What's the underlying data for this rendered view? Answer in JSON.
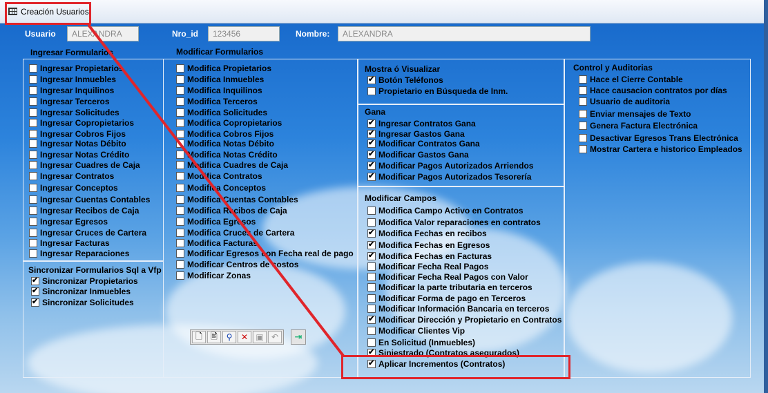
{
  "window": {
    "title": "Creación Usuarios"
  },
  "header": {
    "usuario_label": "Usuario",
    "usuario_value": "ALEXANDRA",
    "nro_id_label": "Nro_id",
    "nro_id_value": "123456",
    "nombre_label": "Nombre:",
    "nombre_value": "ALEXANDRA"
  },
  "ingresar": {
    "title": "Ingresar Formularios",
    "items": [
      {
        "label": "Ingresar Propietarios",
        "checked": false
      },
      {
        "label": "Ingresar Inmuebles",
        "checked": false
      },
      {
        "label": "Ingresar Inquilinos",
        "checked": false
      },
      {
        "label": "Ingresar Terceros",
        "checked": false
      },
      {
        "label": "Ingresar Solicitudes",
        "checked": false
      },
      {
        "label": "Ingresar Copropietarios",
        "checked": false
      },
      {
        "label": "Ingresar Cobros Fijos",
        "checked": false
      },
      {
        "label": "Ingresar Notas Débito",
        "checked": false
      },
      {
        "label": "Ingresar Notas Crédito",
        "checked": false
      },
      {
        "label": "Ingresar Cuadres de Caja",
        "checked": false
      },
      {
        "label": "Ingresar Contratos",
        "checked": false
      },
      {
        "label": "Ingresar Conceptos",
        "checked": false
      },
      {
        "label": "Ingresar Cuentas Contables",
        "checked": false
      },
      {
        "label": "Ingresar Recibos de Caja",
        "checked": false
      },
      {
        "label": "Ingresar Egresos",
        "checked": false
      },
      {
        "label": "Ingresar Cruces de Cartera",
        "checked": false
      },
      {
        "label": "Ingresar Facturas",
        "checked": false
      },
      {
        "label": "Ingresar Reparaciones",
        "checked": false
      }
    ]
  },
  "sincronizar": {
    "title": "Sincronizar Formularios Sql a Vfp",
    "items": [
      {
        "label": "Sincronizar Propietarios",
        "checked": true
      },
      {
        "label": "Sincronizar Inmuebles",
        "checked": true
      },
      {
        "label": "Sincronizar Solicitudes",
        "checked": true
      }
    ]
  },
  "modificar": {
    "title": "Modificar Formularios",
    "items": [
      {
        "label": "Modifica Propietarios",
        "checked": false
      },
      {
        "label": "Modifica Inmuebles",
        "checked": false
      },
      {
        "label": "Modifica Inquilinos",
        "checked": false
      },
      {
        "label": "Modifica Terceros",
        "checked": false
      },
      {
        "label": "Modifica Solicitudes",
        "checked": false
      },
      {
        "label": "Modifica Copropietarios",
        "checked": false
      },
      {
        "label": "Modifica Cobros Fijos",
        "checked": false
      },
      {
        "label": "Modifica Notas Débito",
        "checked": false
      },
      {
        "label": "Modifica Notas Crédito",
        "checked": false
      },
      {
        "label": "Modifica Cuadres de Caja",
        "checked": false
      },
      {
        "label": "Modifica Contratos",
        "checked": false
      },
      {
        "label": "Modifica Conceptos",
        "checked": false
      },
      {
        "label": "Modifica Cuentas Contables",
        "checked": false
      },
      {
        "label": "Modifica Recibos de Caja",
        "checked": false
      },
      {
        "label": "Modifica Egresos",
        "checked": false
      },
      {
        "label": "Modifica Cruces de Cartera",
        "checked": false
      },
      {
        "label": "Modifica Facturas",
        "checked": false
      },
      {
        "label": "Modificar Egresos con Fecha real de pago",
        "checked": false
      },
      {
        "label": "Modificar Centros de costos",
        "checked": false
      },
      {
        "label": "Modificar Zonas",
        "checked": false
      }
    ]
  },
  "mostrar": {
    "title": "Mostra ó Visualizar",
    "items": [
      {
        "label": "Botón Teléfonos",
        "checked": true
      },
      {
        "label": "Propietario en Búsqueda de Inm.",
        "checked": false
      }
    ]
  },
  "gana": {
    "title": "Gana",
    "items": [
      {
        "label": "Ingresar Contratos Gana",
        "checked": true
      },
      {
        "label": "Ingresar Gastos Gana",
        "checked": true
      },
      {
        "label": "Modificar Contratos Gana",
        "checked": true
      },
      {
        "label": "Modificar Gastos Gana",
        "checked": true
      },
      {
        "label": "Modificar Pagos Autorizados Arriendos",
        "checked": true
      },
      {
        "label": "Modificar Pagos Autorizados Tesorería",
        "checked": true
      }
    ]
  },
  "campos": {
    "title": "Modificar Campos",
    "items": [
      {
        "label": "Modifica Campo Activo en Contratos",
        "checked": false
      },
      {
        "label": "Modifica Valor reparaciones en contratos",
        "checked": false
      },
      {
        "label": "Modifica Fechas en recibos",
        "checked": true
      },
      {
        "label": "Modifica Fechas en Egresos",
        "checked": true
      },
      {
        "label": "Modifica Fechas en Facturas",
        "checked": true
      },
      {
        "label": "Modificar Fecha Real Pagos",
        "checked": false
      },
      {
        "label": "Modificar Fecha Real Pagos con Valor",
        "checked": false
      },
      {
        "label": "Modificar la parte tributaria en terceros",
        "checked": false
      },
      {
        "label": "Modificar Forma de pago en Terceros",
        "checked": false
      },
      {
        "label": "Modificar Información Bancaria en terceros",
        "checked": false
      },
      {
        "label": "Modificar Dirección y Propietario en Contratos",
        "checked": true
      },
      {
        "label": "Modificar Clientes Vip",
        "checked": false
      },
      {
        "label": "En Solicitud (Inmuebles)",
        "checked": false
      },
      {
        "label": "Siniestrado (Contratos asegurados)",
        "checked": true
      },
      {
        "label": "Aplicar Incrementos (Contratos)",
        "checked": true
      }
    ]
  },
  "control": {
    "title": "Control y Auditorias",
    "items": [
      {
        "label": "Hace el Cierre Contable",
        "checked": false
      },
      {
        "label": "Hace causacion contratos por días",
        "checked": false
      },
      {
        "label": "Usuario de auditoria",
        "checked": false
      },
      {
        "label": "Enviar mensajes de Texto",
        "checked": false
      },
      {
        "label": "Genera Factura Electrónica",
        "checked": false
      },
      {
        "label": "Desactivar Egresos Trans Electrónica",
        "checked": false
      },
      {
        "label": "Mostrar Cartera e historico Empleados",
        "checked": false
      }
    ]
  },
  "toolbar_icons": [
    "new-icon",
    "edit-icon",
    "find-icon",
    "delete-icon",
    "save-icon",
    "undo-icon",
    "exit-icon"
  ],
  "colors": {
    "annotation": "#e0252b",
    "background": "#2c83dc"
  }
}
